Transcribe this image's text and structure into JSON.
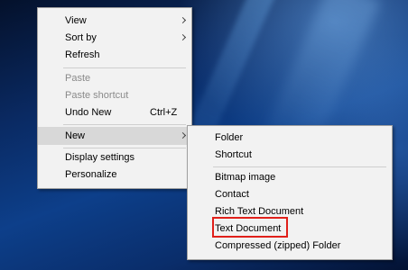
{
  "context_menu": {
    "items": [
      {
        "label": "View"
      },
      {
        "label": "Sort by"
      },
      {
        "label": "Refresh"
      },
      {
        "label": "Paste"
      },
      {
        "label": "Paste shortcut"
      },
      {
        "label": "Undo New",
        "shortcut": "Ctrl+Z"
      },
      {
        "label": "New"
      },
      {
        "label": "Display settings"
      },
      {
        "label": "Personalize"
      }
    ]
  },
  "new_submenu": {
    "items": [
      {
        "label": "Folder"
      },
      {
        "label": "Shortcut"
      },
      {
        "label": "Bitmap image"
      },
      {
        "label": "Contact"
      },
      {
        "label": "Rich Text Document"
      },
      {
        "label": "Text Document"
      },
      {
        "label": "Compressed (zipped) Folder"
      }
    ]
  },
  "colors": {
    "highlight_box": "#e0201a",
    "menu_background": "#f2f2f2",
    "hover": "#d8d8d8"
  },
  "icons": [
    "chevron-right-icon"
  ]
}
